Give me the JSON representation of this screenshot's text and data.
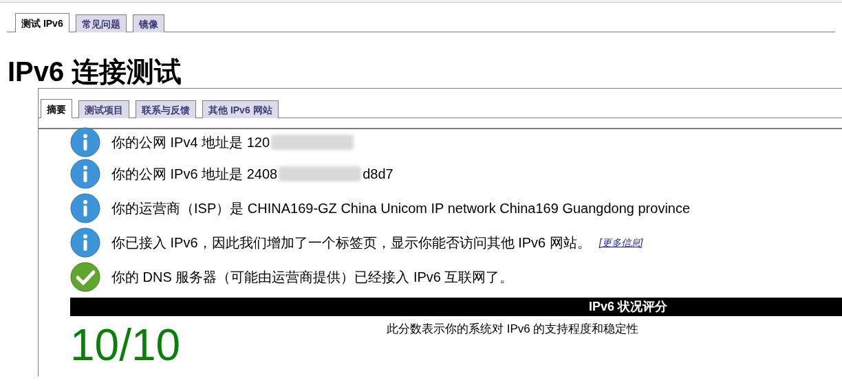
{
  "top_tabs": [
    {
      "label": "测试 IPv6",
      "selected": true
    },
    {
      "label": "常见问题",
      "selected": false
    },
    {
      "label": "镜像",
      "selected": false
    }
  ],
  "title": "IPv6 连接测试",
  "inner_tabs": [
    {
      "label": "摘要",
      "selected": true
    },
    {
      "label": "测试项目",
      "selected": false
    },
    {
      "label": "联系与反馈",
      "selected": false
    },
    {
      "label": "其他 IPv6 网站",
      "selected": false
    }
  ],
  "messages": [
    {
      "kind": "info",
      "segments": [
        {
          "kind": "text",
          "text": "你的公网 IPv4 地址是 120"
        },
        {
          "kind": "redacted"
        }
      ]
    },
    {
      "kind": "info",
      "segments": [
        {
          "kind": "text",
          "text": "你的公网 IPv6 地址是 2408"
        },
        {
          "kind": "redacted"
        },
        {
          "kind": "text",
          "text": "d8d7"
        }
      ]
    },
    {
      "kind": "info",
      "segments": [
        {
          "kind": "text",
          "text": "你的运营商（ISP）是 CHINA169-GZ China Unicom IP network China169 Guangdong province"
        }
      ]
    },
    {
      "kind": "info",
      "segments": [
        {
          "kind": "text",
          "text": "你已接入 IPv6，因此我们增加了一个标签页，显示你能否访问其他 IPv6 网站。"
        },
        {
          "kind": "link",
          "text": "[更多信息]"
        }
      ]
    },
    {
      "kind": "ok",
      "segments": [
        {
          "kind": "text",
          "text": "你的 DNS 服务器（可能由运营商提供）已经接入 IPv6 互联网了。"
        }
      ]
    }
  ],
  "score": {
    "heading": "IPv6 状况评分",
    "value": "10/10",
    "description": "此分数表示你的系统对 IPv6 的支持程度和稳定性"
  }
}
